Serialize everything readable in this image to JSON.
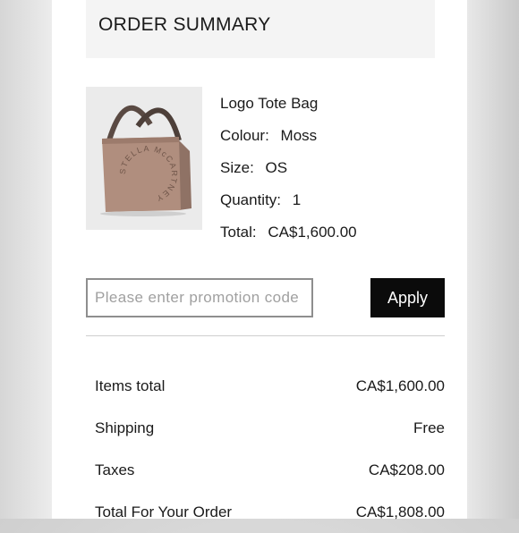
{
  "summary": {
    "title": "ORDER SUMMARY"
  },
  "product": {
    "name": "Logo Tote Bag",
    "colour_label": "Colour:",
    "colour_value": "Moss",
    "size_label": "Size:",
    "size_value": "OS",
    "quantity_label": "Quantity:",
    "quantity_value": "1",
    "total_label": "Total:",
    "total_value": "CA$1,600.00",
    "logo_text": "STELLA McCARTNEY"
  },
  "promo": {
    "placeholder": "Please enter promotion code",
    "apply_label": "Apply"
  },
  "totals": {
    "items_total_label": "Items total",
    "items_total_value": "CA$1,600.00",
    "shipping_label": "Shipping",
    "shipping_value": "Free",
    "taxes_label": "Taxes",
    "taxes_value": "CA$208.00",
    "order_total_label": "Total For Your Order",
    "order_total_value": "CA$1,808.00"
  },
  "colors": {
    "background": "#ffffff",
    "header_bg": "#f4f4f4",
    "button_bg": "#0b0b0b",
    "text": "#1a1a1a",
    "bag": "#b08e7e"
  }
}
